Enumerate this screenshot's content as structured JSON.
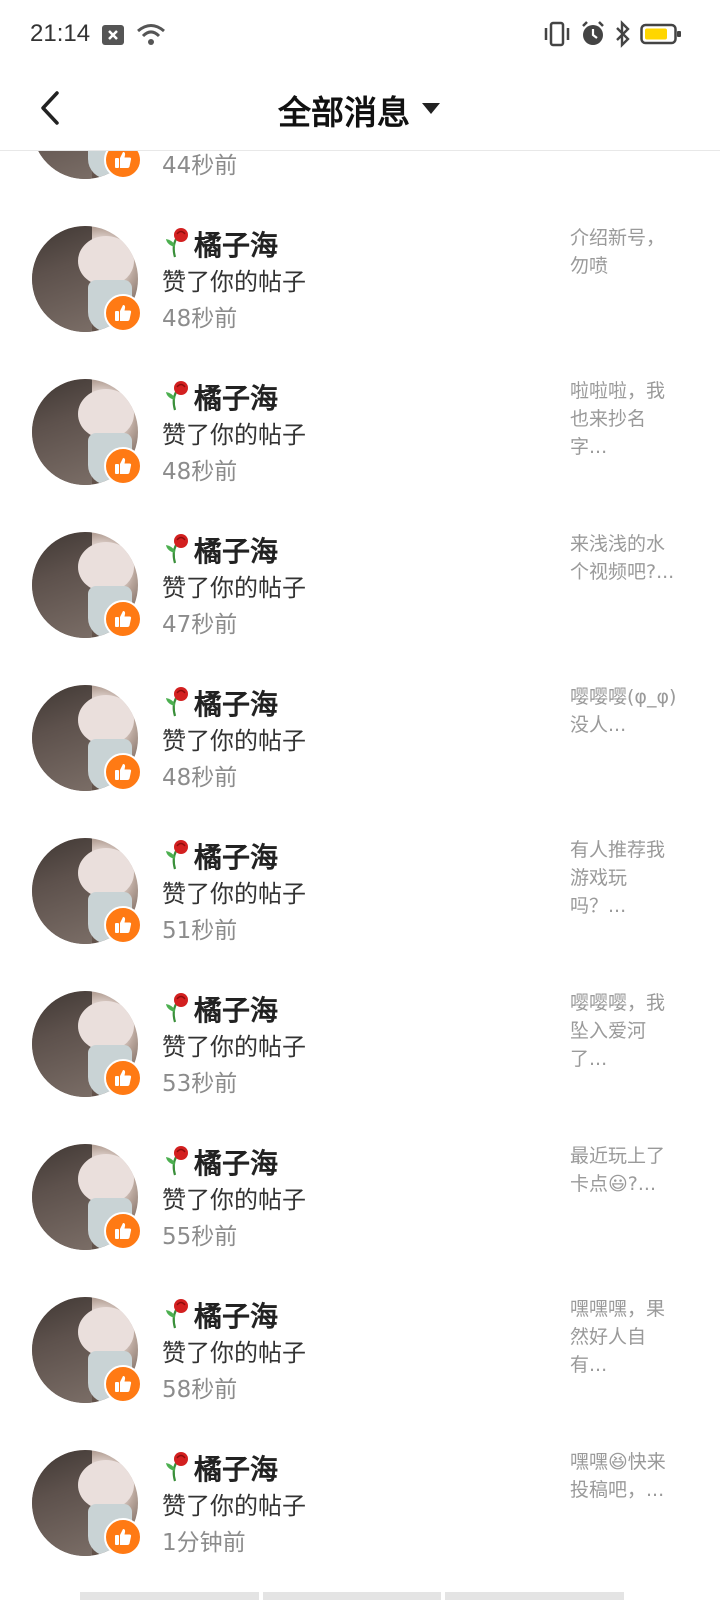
{
  "status_bar": {
    "time": "21:14",
    "left_icons": [
      "close-box-icon",
      "wifi-icon"
    ],
    "right_icons": [
      "vibrate-icon",
      "alarm-icon",
      "bluetooth-icon",
      "battery-icon"
    ],
    "battery_color": "#ffd600"
  },
  "header": {
    "title": "全部消息",
    "back_icon": "chevron-left-icon",
    "dropdown_icon": "triangle-down-icon"
  },
  "colors": {
    "like_badge": "#ff7a14",
    "name": "#222222",
    "secondary": "#8c8c8c"
  },
  "messages": [
    {
      "name": "",
      "action": "",
      "time": "44秒前",
      "preview": ""
    },
    {
      "name": "橘子海",
      "action": "赞了你的帖子",
      "time": "48秒前",
      "preview": "介绍新号，勿喷"
    },
    {
      "name": "橘子海",
      "action": "赞了你的帖子",
      "time": "48秒前",
      "preview": "啦啦啦，我也来抄名字..."
    },
    {
      "name": "橘子海",
      "action": "赞了你的帖子",
      "time": "47秒前",
      "preview": "来浅浅的水个视频吧?..."
    },
    {
      "name": "橘子海",
      "action": "赞了你的帖子",
      "time": "48秒前",
      "preview": "嘤嘤嘤(φ_φ)没人..."
    },
    {
      "name": "橘子海",
      "action": "赞了你的帖子",
      "time": "51秒前",
      "preview": "有人推荐我游戏玩吗？..."
    },
    {
      "name": "橘子海",
      "action": "赞了你的帖子",
      "time": "53秒前",
      "preview": "嘤嘤嘤，我坠入爱河了..."
    },
    {
      "name": "橘子海",
      "action": "赞了你的帖子",
      "time": "55秒前",
      "preview": "最近玩上了卡点😃?..."
    },
    {
      "name": "橘子海",
      "action": "赞了你的帖子",
      "time": "58秒前",
      "preview": "嘿嘿嘿，果然好人自有..."
    },
    {
      "name": "橘子海",
      "action": "赞了你的帖子",
      "time": "1分钟前",
      "preview": "嘿嘿😆快来投稿吧，..."
    }
  ]
}
